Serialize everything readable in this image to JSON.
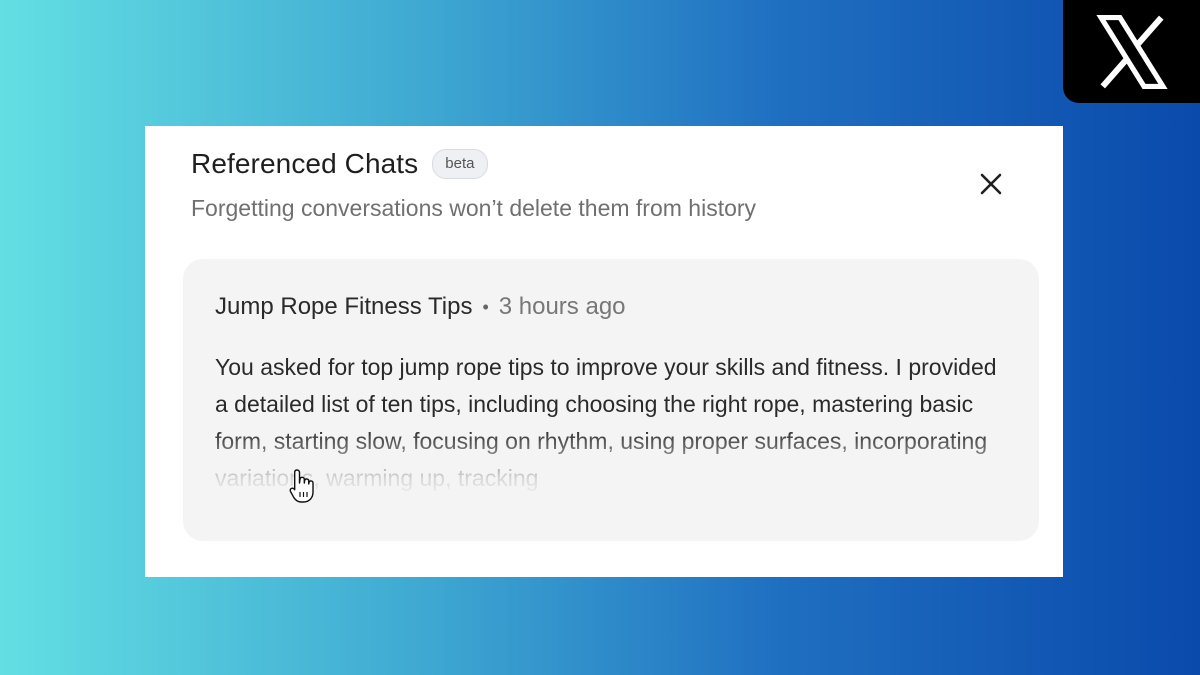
{
  "panel": {
    "title": "Referenced Chats",
    "badge": "beta",
    "subtitle": "Forgetting conversations won’t delete them from history"
  },
  "chat_card": {
    "title": "Jump Rope Fitness Tips",
    "separator": "•",
    "time": "3 hours ago",
    "summary": "You asked for top jump rope tips to improve your skills and fitness. I provided a detailed list of ten tips, including choosing the right rope, mastering basic form, starting slow, focusing on rhythm, using proper surfaces, incorporating variations, warming up, tracking"
  },
  "icons": {
    "close": "close-icon",
    "brand": "x-logo-icon",
    "cursor": "hand-pointer-icon"
  },
  "colors": {
    "background_start": "#63dfe3",
    "background_end": "#0a4aab",
    "panel": "#ffffff",
    "card": "#f4f4f4"
  }
}
